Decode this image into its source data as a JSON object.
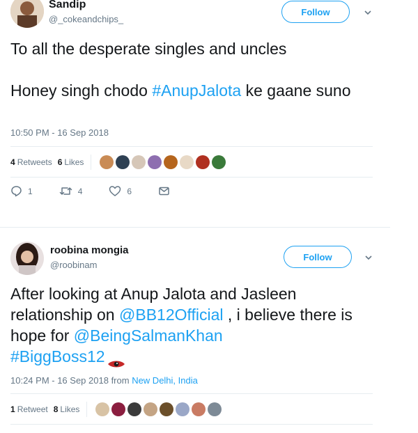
{
  "tweet1": {
    "name": "Sandip",
    "handle": "@_cokeandchips_",
    "follow_label": "Follow",
    "line1": "To all the desperate singles and uncles",
    "line2_prefix": "Honey singh chodo ",
    "hashtag": "#AnupJalota",
    "line2_suffix": " ke gaane suno",
    "timestamp": "10:50 PM - 16 Sep 2018",
    "retweets_count": "4",
    "retweets_label": "Retweets",
    "likes_count": "6",
    "likes_label": "Likes",
    "reply_count": "1",
    "retweet_action_count": "4",
    "like_action_count": "6",
    "liker_colors": [
      "#c98b55",
      "#2e4053",
      "#d6c7b8",
      "#8e6fb0",
      "#b5651d",
      "#e8d9c6",
      "#b03020",
      "#3a7a3a"
    ]
  },
  "tweet2": {
    "name": "roobina mongia",
    "handle": "@roobinam",
    "follow_label": "Follow",
    "text_prefix": "After looking at Anup Jalota and Jasleen relationship on ",
    "mention1": "@BB12Official",
    "text_mid": " , i believe there is hope for ",
    "mention2": "@BeingSalmanKhan",
    "hashtag": "#BiggBoss12",
    "emoji": "👁",
    "timestamp": "10:24 PM - 16 Sep 2018",
    "from_label": "from",
    "location": "New Delhi, India",
    "retweets_count": "1",
    "retweets_label": "Retweet",
    "likes_count": "8",
    "likes_label": "Likes",
    "liker_colors": [
      "#d8c3a5",
      "#8b1e3f",
      "#3b3b3b",
      "#c4a484",
      "#6b4f2a",
      "#9aa7c7",
      "#c97b63",
      "#7d8a96"
    ]
  }
}
